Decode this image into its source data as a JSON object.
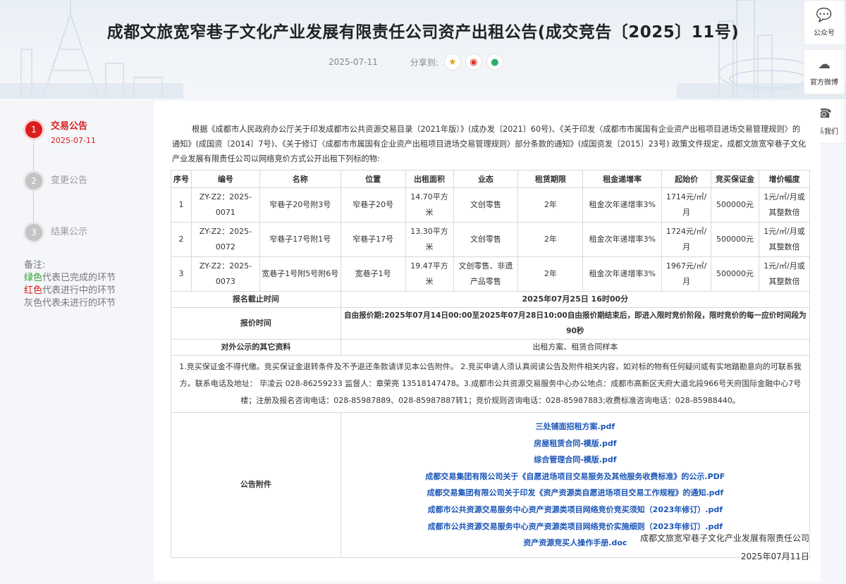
{
  "header": {
    "title": "成都文旅宽窄巷子文化产业发展有限责任公司资产出租公告(成交竞告〔2025〕11号)",
    "date": "2025-07-11",
    "share_label": "分享到:",
    "share_icons": [
      "star-icon",
      "weibo-icon",
      "wechat-icon"
    ]
  },
  "side_tools": [
    {
      "label": "公众号",
      "icon": "wechat-icon"
    },
    {
      "label": "官方微博",
      "icon": "weibo-icon"
    },
    {
      "label": "联系我们",
      "icon": "phone-icon"
    }
  ],
  "steps": [
    {
      "num": "1",
      "label": "交易公告",
      "date": "2025-07-11",
      "state": "active"
    },
    {
      "num": "2",
      "label": "变更公告",
      "state": "todo"
    },
    {
      "num": "3",
      "label": "结果公示",
      "state": "todo"
    }
  ],
  "notes": {
    "title": "备注:",
    "green_word": "绿色",
    "green_rest": "代表已完成的环节",
    "red_word": "红色",
    "red_rest": "代表进行中的环节",
    "gray_line": "灰色代表未进行的环节"
  },
  "intro": "根据《成都市人民政府办公厅关于印发成都市公共资源交易目录（2021年版）》(成办发〔2021〕60号)、《关于印发〈成都市市属国有企业资产出租项目进场交易管理规则〉的通知》(成国资〔2014〕7号)、《关于修订〈成都市市属国有企业资产出租项目进场交易管理规则〉部分条款的通知》(成国资发〔2015〕23号) 政策文件规定，成都文旅宽窄巷子文化产业发展有限责任公司以网络竞价方式公开出租下列标的物:",
  "table": {
    "headers": [
      "序号",
      "编号",
      "名称",
      "位置",
      "出租面积",
      "业态",
      "租赁期限",
      "租金递增率",
      "起始价",
      "竞买保证金",
      "增价幅度"
    ],
    "rows": [
      [
        "1",
        "ZY-Z2：2025-0071",
        "窄巷子20号附3号",
        "窄巷子20号",
        "14.70平方米",
        "文创零售",
        "2年",
        "租金次年递增率3%",
        "1714元/㎡/月",
        "500000元",
        "1元/㎡/月或其整数倍"
      ],
      [
        "2",
        "ZY-Z2：2025-0072",
        "窄巷子17号附1号",
        "窄巷子17号",
        "13.30平方米",
        "文创零售",
        "2年",
        "租金次年递增率3%",
        "1724元/㎡/月",
        "500000元",
        "1元/㎡/月或其整数倍"
      ],
      [
        "3",
        "ZY-Z2：2025-0073",
        "宽巷子1号附5号附6号",
        "宽巷子1号",
        "19.47平方米",
        "文创零售、非遗产品零售",
        "2年",
        "租金次年递增率3%",
        "1967元/㎡/月",
        "500000元",
        "1元/㎡/月或其整数倍"
      ]
    ],
    "deadline_label": "报名截止时间",
    "deadline_value": "2025年07月25日 16时00分",
    "quote_label": "报价时间",
    "quote_value": "自由报价期:2025年07月14日00:00至2025年07月28日10:00自由报价期结束后，即进入限时竞价阶段，限时竞价的每一应价时间段为90秒",
    "other_label": "对外公示的其它资料",
    "other_value": "出租方案、租赁合同样本",
    "notes_text": "1.竞买保证金不得代缴。竞买保证金退转条件及不予退还条款请详见本公告附件。 2.竞买申请人须认真阅读公告及附件相关内容，如对标的物有任何疑问或有实地踏勘意向的可联系我方。联系电话及地址： 毕凌云 028-86259233 监督人：章荣亮 13518147478。3.成都市公共资源交易服务中心办公地点：成都市高新区天府大道北段966号天府国际金融中心7号楼；注册及报名咨询电话：028-85987889、028-85987887转1；竞价规则咨询电话：028-85987883;收费标准咨询电话：028-85988440。",
    "attach_label": "公告附件",
    "attachments": [
      "三处铺面招租方案.pdf",
      "房屋租赁合同-模版.pdf",
      "综合管理合同-模版.pdf",
      "成都交易集团有限公司关于《自愿进场项目交易服务及其他服务收费标准》的公示.PDF",
      "成都交易集团有限公司关于印发《资产资源类自愿进场项目交易工作规程》的通知.pdf",
      "成都市公共资源交易服务中心资产资源类项目网络竞价竞买须知（2023年修订）.pdf",
      "成都市公共资源交易服务中心资产资源类项目网络竞价实施细则（2023年修订）.pdf",
      "资产资源竞买人操作手册.doc"
    ]
  },
  "signoff": {
    "company": "成都文旅宽窄巷子文化产业发展有限责任公司",
    "date": "2025年07月11日"
  }
}
